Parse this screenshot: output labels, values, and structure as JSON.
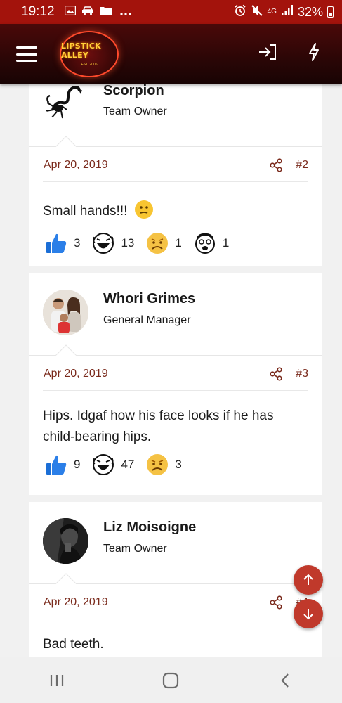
{
  "status_bar": {
    "time": "19:12",
    "network": "4G",
    "battery": "32%",
    "icons": [
      "image-icon",
      "car-icon",
      "folder-icon",
      "more-icon",
      "alarm-icon",
      "mute-icon",
      "signal-icon",
      "battery-icon"
    ]
  },
  "app_bar": {
    "logo_text": "LIPSTICK ALLEY",
    "logo_sub": "EST. 2006",
    "icons": [
      "menu-icon",
      "login-icon",
      "bolt-icon"
    ]
  },
  "posts": [
    {
      "username": "Scorpion",
      "role": "Team Owner",
      "date": "Apr 20, 2019",
      "post_number": "#2",
      "body": "Small hands!!!",
      "body_emoji": "confused-emoji",
      "reactions": [
        {
          "icon": "like-icon",
          "count": "3"
        },
        {
          "icon": "laugh-icon",
          "count": "13"
        },
        {
          "icon": "sad-icon",
          "count": "1"
        },
        {
          "icon": "shocked-icon",
          "count": "1"
        }
      ]
    },
    {
      "username": "Whori Grimes",
      "role": "General Manager",
      "date": "Apr 20, 2019",
      "post_number": "#3",
      "body": "Hips. Idgaf how his face looks if he has child-bearing hips.",
      "reactions": [
        {
          "icon": "like-icon",
          "count": "9"
        },
        {
          "icon": "laugh-icon",
          "count": "47"
        },
        {
          "icon": "sad-icon",
          "count": "3"
        }
      ]
    },
    {
      "username": "Liz Moisoigne",
      "role": "Team Owner",
      "date": "Apr 20, 2019",
      "post_number": "#4",
      "body": "Bad teeth."
    }
  ],
  "fabs": {
    "up_icon": "arrow-up-icon",
    "down_icon": "arrow-down-icon",
    "color": "#c0392b"
  },
  "nav_bar": {
    "icons": [
      "recents-icon",
      "home-icon",
      "back-icon"
    ]
  },
  "colors": {
    "status_bar": "#a3130c",
    "accent": "#7a2a1c"
  }
}
